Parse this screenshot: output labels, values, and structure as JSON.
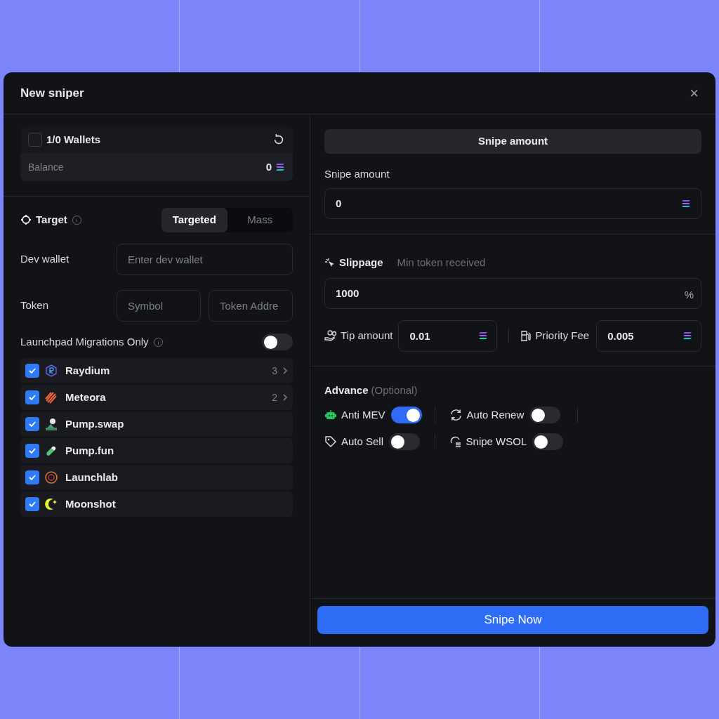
{
  "window": {
    "title": "New sniper",
    "close": "×"
  },
  "wallets": {
    "label": "1/0 Wallets",
    "checked": false,
    "balance_label": "Balance",
    "balance": "0"
  },
  "target": {
    "label": "Target",
    "tabs": [
      {
        "label": "Targeted",
        "selected": true
      },
      {
        "label": "Mass",
        "selected": false
      }
    ]
  },
  "dev_wallet": {
    "label": "Dev wallet",
    "placeholder": "Enter dev wallet"
  },
  "token": {
    "label": "Token",
    "symbol_placeholder": "Symbol",
    "address_placeholder": "Token Addre"
  },
  "launchpad_migrations": {
    "label": "Launchpad Migrations Only",
    "on": false
  },
  "platforms": [
    {
      "name": "Raydium",
      "checked": true,
      "count": "3"
    },
    {
      "name": "Meteora",
      "checked": true,
      "count": "2"
    },
    {
      "name": "Pump.swap",
      "checked": true
    },
    {
      "name": "Pump.fun",
      "checked": true
    },
    {
      "name": "Launchlab",
      "checked": true
    },
    {
      "name": "Moonshot",
      "checked": true
    }
  ],
  "snipe_amount": {
    "header": "Snipe amount",
    "label": "Snipe amount",
    "value": "0"
  },
  "slippage": {
    "label": "Slippage",
    "hint": "Min token received",
    "value": "1000",
    "unit": "%"
  },
  "tip_amount": {
    "label": "Tip amount",
    "value": "0.01"
  },
  "priority_fee": {
    "label": "Priority Fee",
    "value": "0.005"
  },
  "advance": {
    "title": "Advance",
    "subtitle": "(Optional)",
    "options": [
      {
        "label": "Anti MEV",
        "on": true
      },
      {
        "label": "Auto Renew",
        "on": false
      },
      {
        "label": "Auto Sell",
        "on": false
      },
      {
        "label": "Snipe WSOL",
        "on": false
      }
    ]
  },
  "submit": "Snipe Now"
}
